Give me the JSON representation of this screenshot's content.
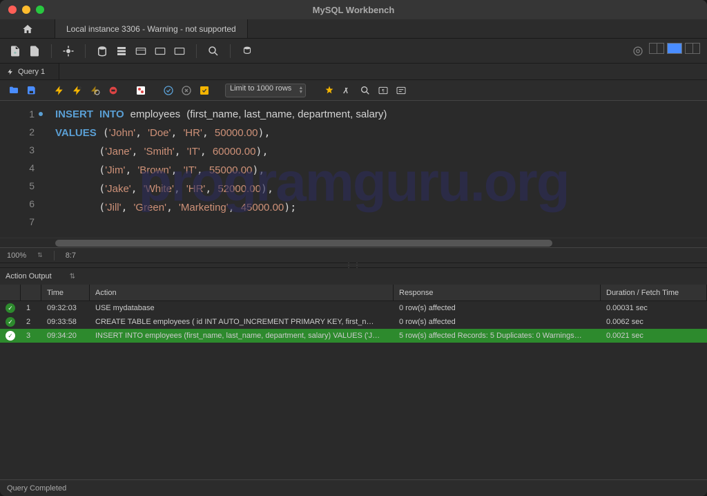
{
  "window": {
    "title": "MySQL Workbench"
  },
  "connection_tab": "Local instance 3306 - Warning - not supported",
  "query_tab": "Query 1",
  "limit_select": "Limit to 1000 rows",
  "editor_lines": [
    "1",
    "2",
    "3",
    "4",
    "5",
    "6",
    "7"
  ],
  "code": {
    "l1": {
      "kw1": "INSERT",
      "kw2": "INTO",
      "id": "employees",
      "cols": "(first_name, last_name, department, salary)"
    },
    "l2": {
      "kw": "VALUES",
      "s1": "'John'",
      "s2": "'Doe'",
      "s3": "'HR'",
      "n": "50000.00"
    },
    "l3": {
      "s1": "'Jane'",
      "s2": "'Smith'",
      "s3": "'IT'",
      "n": "60000.00"
    },
    "l4": {
      "s1": "'Jim'",
      "s2": "'Brown'",
      "s3": "'IT'",
      "n": "55000.00"
    },
    "l5": {
      "s1": "'Jake'",
      "s2": "'White'",
      "s3": "'HR'",
      "n": "52000.00"
    },
    "l6": {
      "s1": "'Jill'",
      "s2": "'Green'",
      "s3": "'Marketing'",
      "n": "45000.00"
    }
  },
  "watermark": "programguru.org",
  "status": {
    "zoom": "100%",
    "pos": "8:7"
  },
  "output_panel": "Action Output",
  "output_headers": {
    "time": "Time",
    "action": "Action",
    "response": "Response",
    "duration": "Duration / Fetch Time"
  },
  "output_rows": [
    {
      "n": "1",
      "time": "09:32:03",
      "action": "USE mydatabase",
      "response": "0 row(s) affected",
      "duration": "0.00031 sec"
    },
    {
      "n": "2",
      "time": "09:33:58",
      "action": "CREATE TABLE employees (     id INT AUTO_INCREMENT PRIMARY KEY,     first_n…",
      "response": "0 row(s) affected",
      "duration": "0.0062 sec"
    },
    {
      "n": "3",
      "time": "09:34:20",
      "action": "INSERT INTO employees (first_name, last_name, department, salary) VALUES ('J…",
      "response": "5 row(s) affected Records: 5  Duplicates: 0  Warnings…",
      "duration": "0.0021 sec"
    }
  ],
  "footer": "Query Completed"
}
